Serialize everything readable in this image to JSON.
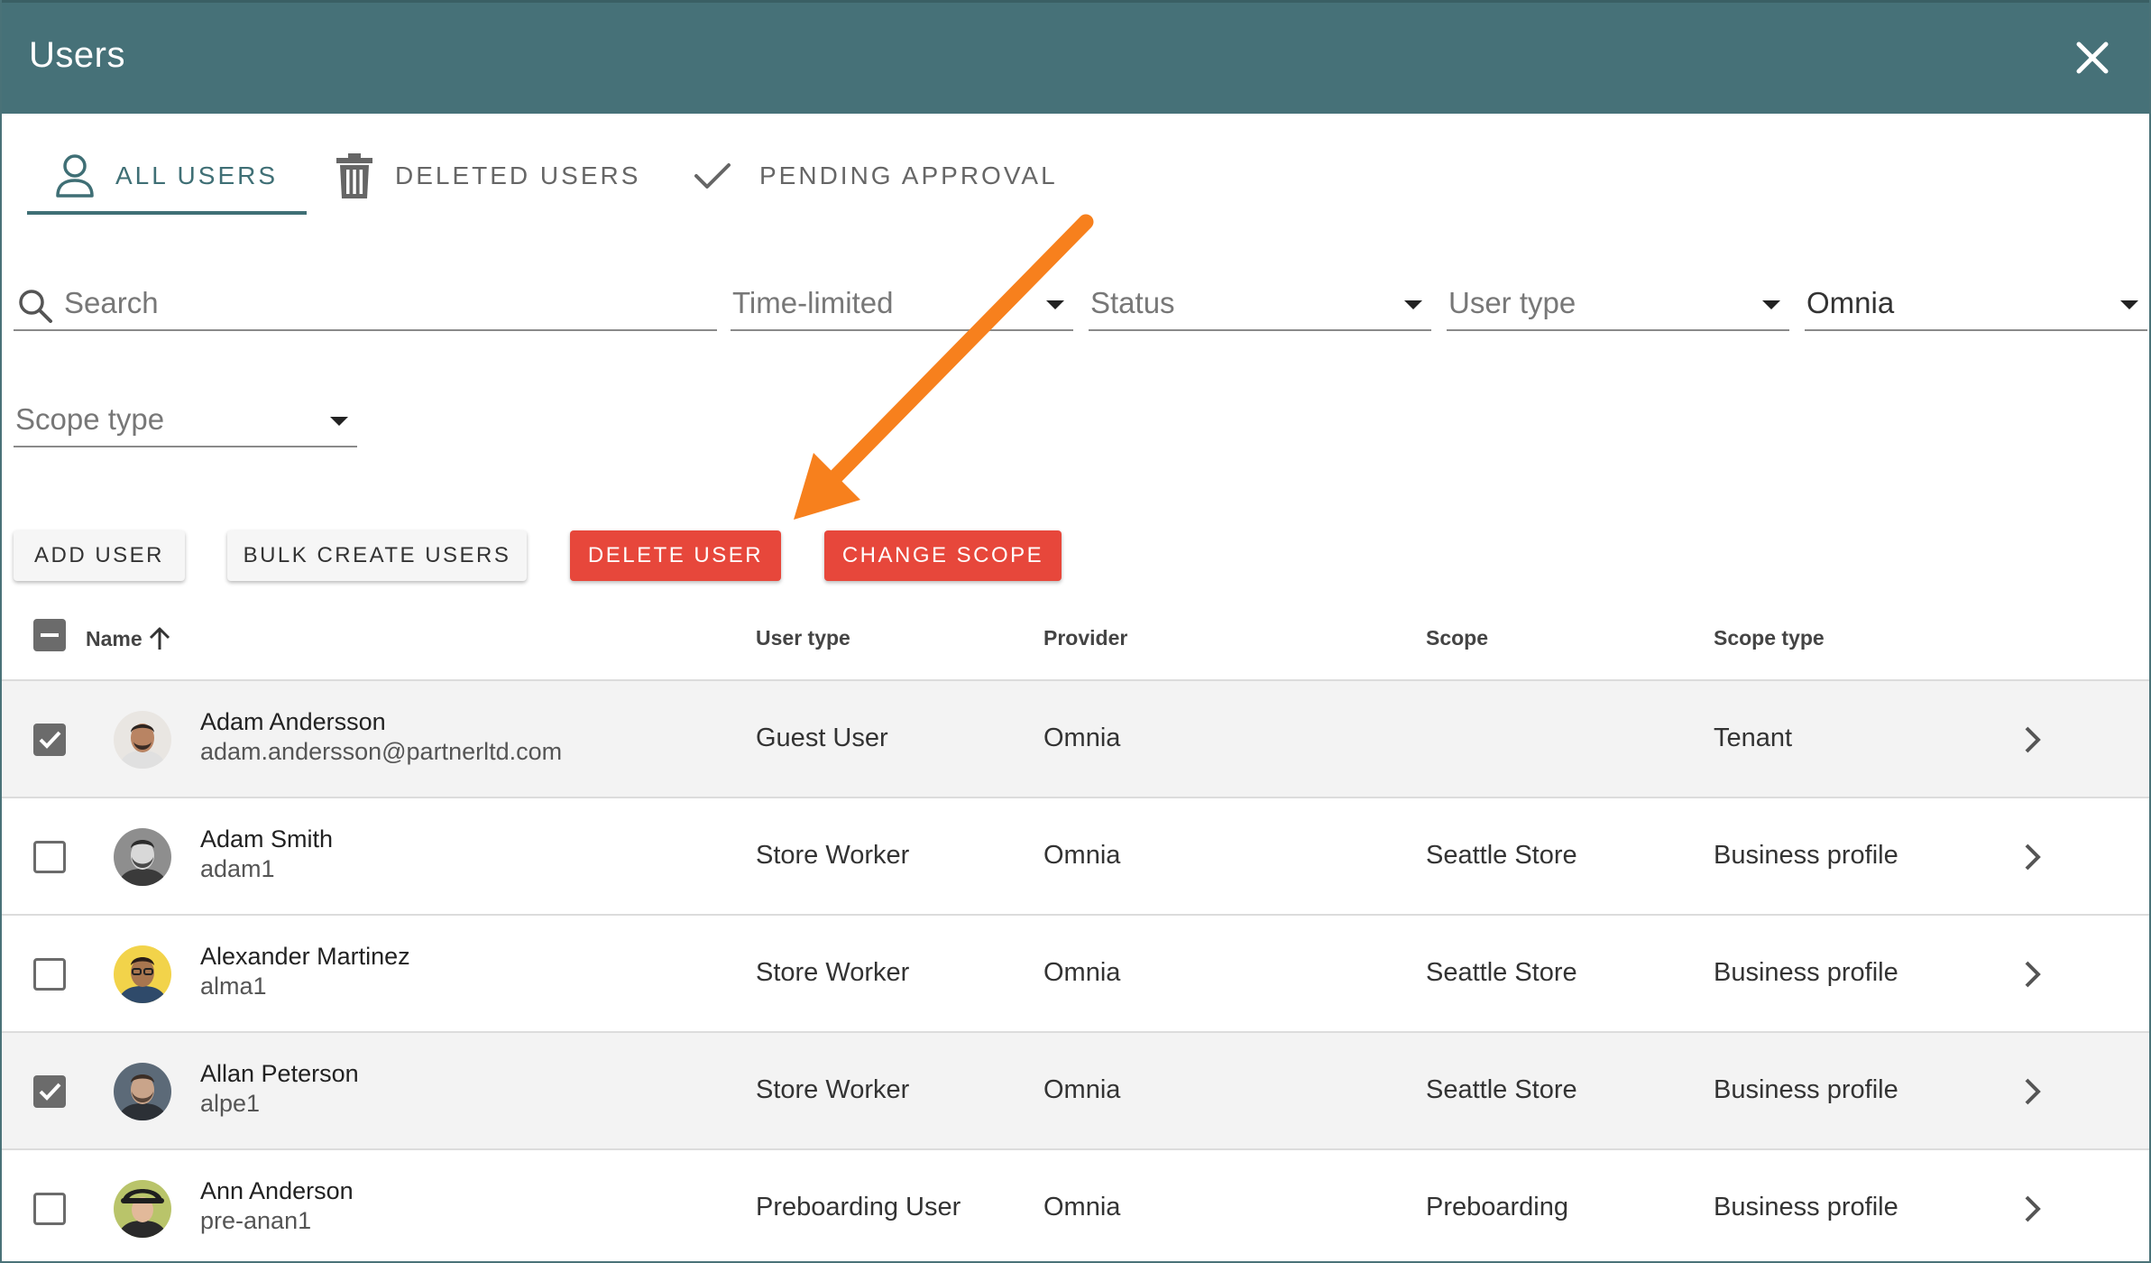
{
  "window": {
    "title": "Users"
  },
  "tabs": [
    {
      "label": "ALL USERS",
      "icon": "person-icon",
      "active": true
    },
    {
      "label": "DELETED USERS",
      "icon": "trash-icon",
      "active": false
    },
    {
      "label": "PENDING APPROVAL",
      "icon": "check-icon",
      "active": false
    }
  ],
  "filters": {
    "search_placeholder": "Search",
    "time_limited": "Time-limited",
    "status": "Status",
    "user_type": "User type",
    "provider_value": "Omnia",
    "scope_type": "Scope type"
  },
  "actions": {
    "add_user": "ADD USER",
    "bulk_create": "BULK CREATE USERS",
    "delete_user": "DELETE USER",
    "change_scope": "CHANGE SCOPE"
  },
  "table": {
    "columns": {
      "name": "Name",
      "user_type": "User type",
      "provider": "Provider",
      "scope": "Scope",
      "scope_type": "Scope type"
    },
    "rows": [
      {
        "name": "Adam Andersson",
        "sub": "adam.andersson@partnerltd.com",
        "user_type": "Guest User",
        "provider": "Omnia",
        "scope": "",
        "scope_type": "Tenant",
        "checked": true
      },
      {
        "name": "Adam Smith",
        "sub": "adam1",
        "user_type": "Store Worker",
        "provider": "Omnia",
        "scope": "Seattle Store",
        "scope_type": "Business profile",
        "checked": false
      },
      {
        "name": "Alexander Martinez",
        "sub": "alma1",
        "user_type": "Store Worker",
        "provider": "Omnia",
        "scope": "Seattle Store",
        "scope_type": "Business profile",
        "checked": false
      },
      {
        "name": "Allan Peterson",
        "sub": "alpe1",
        "user_type": "Store Worker",
        "provider": "Omnia",
        "scope": "Seattle Store",
        "scope_type": "Business profile",
        "checked": true
      },
      {
        "name": "Ann Anderson",
        "sub": "pre-anan1",
        "user_type": "Preboarding User",
        "provider": "Omnia",
        "scope": "Preboarding",
        "scope_type": "Business profile",
        "checked": false
      }
    ]
  },
  "colors": {
    "header": "#467178",
    "accent": "#3f6f75",
    "danger": "#e7473b",
    "annotation_arrow": "#f7801d"
  }
}
